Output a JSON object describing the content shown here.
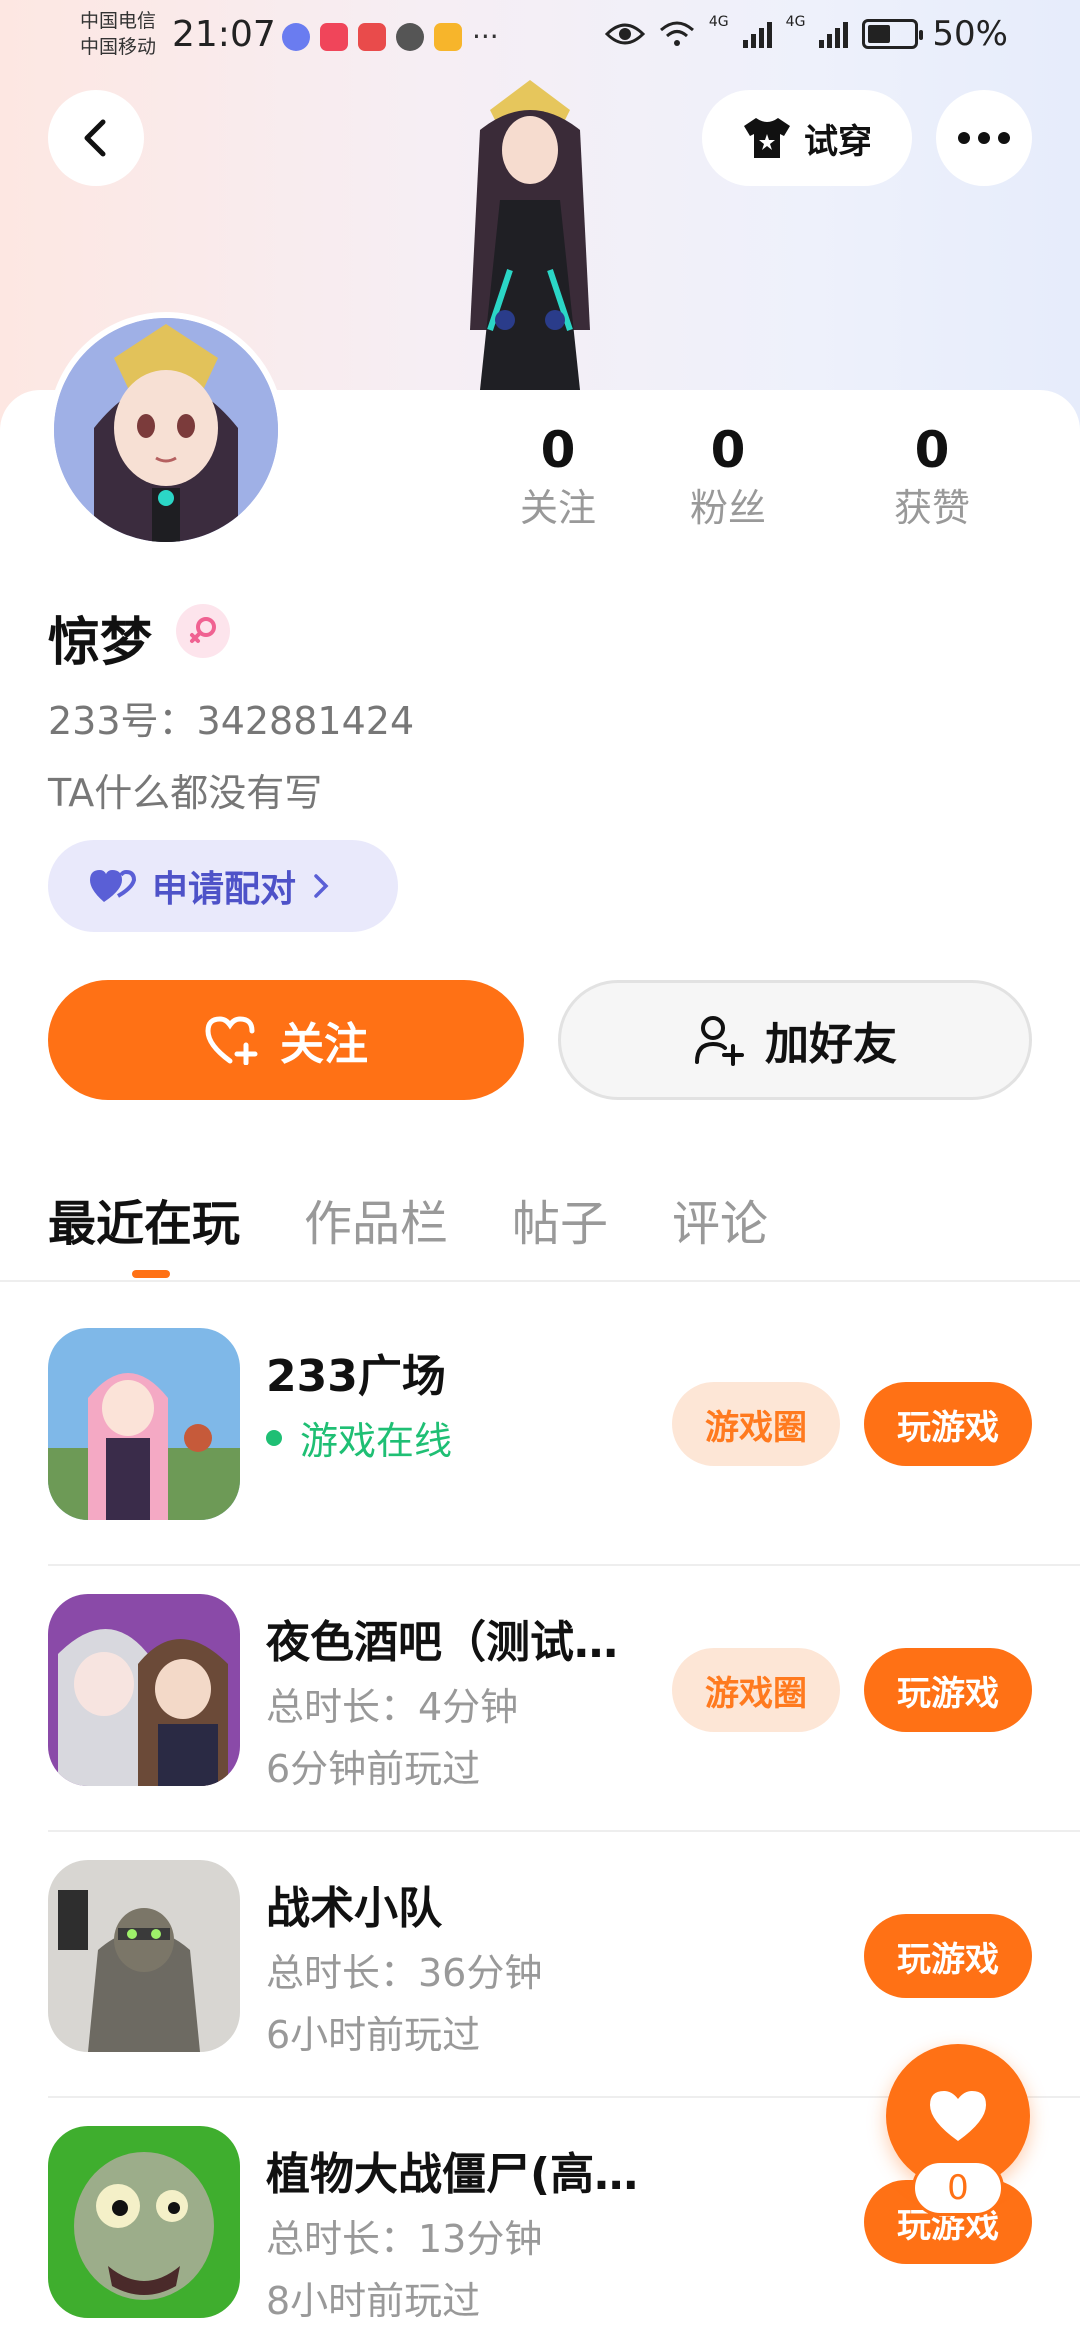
{
  "status_bar": {
    "carrier_1": "中国电信",
    "carrier_2": "中国移动",
    "time": "21:07",
    "network_1": "4G",
    "network_2": "4G",
    "battery": "50%"
  },
  "header": {
    "tryon_label": "试穿"
  },
  "profile": {
    "name": "惊梦",
    "uid": "233号：342881424",
    "bio": "TA什么都没有写",
    "pair_label": "申请配对",
    "stats": [
      {
        "value": "0",
        "label": "关注"
      },
      {
        "value": "0",
        "label": "粉丝"
      },
      {
        "value": "0",
        "label": "获赞"
      }
    ],
    "follow_label": "关注",
    "add_friend_label": "加好友"
  },
  "tabs": [
    {
      "label": "最近在玩",
      "active": true
    },
    {
      "label": "作品栏",
      "active": false
    },
    {
      "label": "帖子",
      "active": false
    },
    {
      "label": "评论",
      "active": false
    }
  ],
  "games": [
    {
      "title": "233广场",
      "sub1": "游戏在线",
      "sub2": "",
      "online": true,
      "circle_label": "游戏圈",
      "play_label": "玩游戏"
    },
    {
      "title": "夜色酒吧（测试…",
      "sub1": "总时长：4分钟",
      "sub2": "6分钟前玩过",
      "online": false,
      "circle_label": "游戏圈",
      "play_label": "玩游戏"
    },
    {
      "title": "战术小队",
      "sub1": "总时长：36分钟",
      "sub2": "6小时前玩过",
      "online": false,
      "circle_label": "",
      "play_label": "玩游戏"
    },
    {
      "title": "植物大战僵尸(高清版)",
      "sub1": "总时长：13分钟",
      "sub2": "8小时前玩过",
      "online": false,
      "circle_label": "",
      "play_label": "玩游戏"
    }
  ],
  "floating": {
    "like_count": "0"
  },
  "colors": {
    "accent": "#ff7115",
    "online": "#1fbf74",
    "pair": "#4e52c8"
  }
}
